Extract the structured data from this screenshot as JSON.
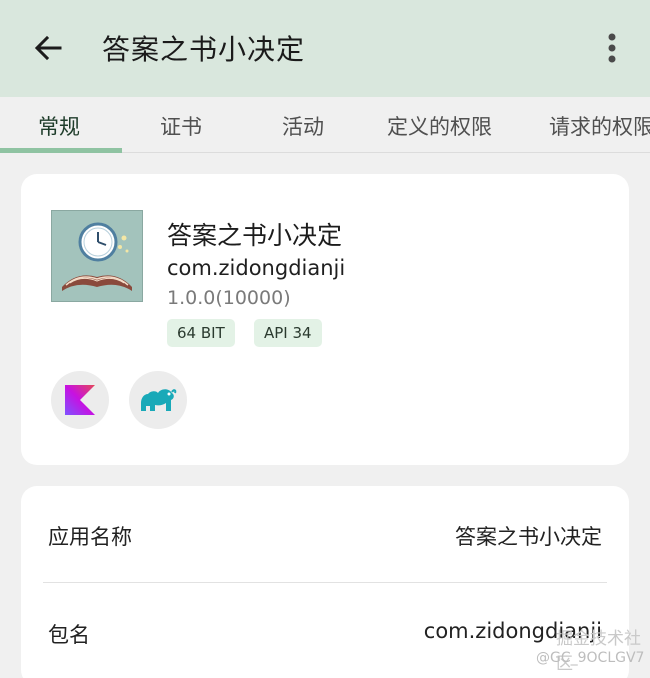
{
  "header": {
    "title": "答案之书小决定"
  },
  "tabs": [
    {
      "label": "常规"
    },
    {
      "label": "证书"
    },
    {
      "label": "活动"
    },
    {
      "label": "定义的权限"
    },
    {
      "label": "请求的权限"
    }
  ],
  "app": {
    "name": "答案之书小决定",
    "package": "com.zidongdianji",
    "version": "1.0.0(10000)",
    "badges": [
      "64 BIT",
      "API 34"
    ],
    "libraries": [
      "kotlin-icon",
      "gradle-icon"
    ]
  },
  "details": [
    {
      "label": "应用名称",
      "value": "答案之书小决定"
    },
    {
      "label": "包名",
      "value": "com.zidongdianji"
    }
  ],
  "watermark": {
    "line1": "掘金技术社区",
    "line2": "@GC_9OCLGV7"
  },
  "colors": {
    "topbar": "#d9e7dd",
    "accent": "#8fc3a2",
    "badge_bg": "#e3f2e6",
    "background": "#f0f0f0"
  }
}
